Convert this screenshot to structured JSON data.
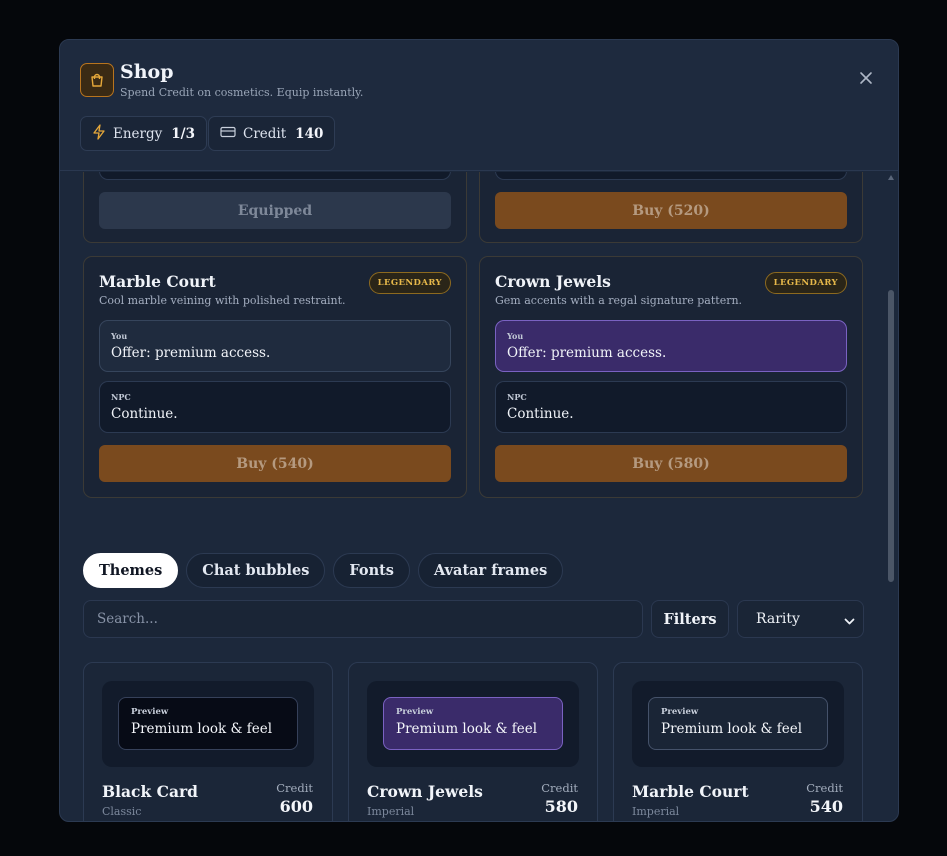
{
  "header": {
    "title": "Shop",
    "subtitle": "Spend Credit on cosmetics. Equip instantly.",
    "energy": {
      "label": "Energy",
      "value": "1/3"
    },
    "credit": {
      "label": "Credit",
      "value": "140"
    }
  },
  "top_cards": [
    {
      "button": "Equipped"
    },
    {
      "button": "Buy (520)"
    }
  ],
  "cards": [
    {
      "title": "Marble Court",
      "badge": "LEGENDARY",
      "desc": "Cool marble veining with polished restraint.",
      "you_label": "You",
      "you_msg": "Offer: premium access.",
      "npc_label": "NPC",
      "npc_msg": "Continue.",
      "button": "Buy (540)"
    },
    {
      "title": "Crown Jewels",
      "badge": "LEGENDARY",
      "desc": "Gem accents with a regal signature pattern.",
      "you_label": "You",
      "you_msg": "Offer: premium access.",
      "npc_label": "NPC",
      "npc_msg": "Continue.",
      "button": "Buy (580)"
    }
  ],
  "tabs": [
    "Themes",
    "Chat bubbles",
    "Fonts",
    "Avatar frames"
  ],
  "active_tab": "Themes",
  "search": {
    "placeholder": "Search..."
  },
  "filters_label": "Filters",
  "rarity": {
    "selected": "Rarity"
  },
  "tiles": [
    {
      "name": "Black Card",
      "sub": "Classic",
      "credit_label": "Credit",
      "price": "600",
      "preview_label": "Preview",
      "preview_text": "Premium look & feel"
    },
    {
      "name": "Crown Jewels",
      "sub": "Imperial",
      "credit_label": "Credit",
      "price": "580",
      "preview_label": "Preview",
      "preview_text": "Premium look & feel"
    },
    {
      "name": "Marble Court",
      "sub": "Imperial",
      "credit_label": "Credit",
      "price": "540",
      "preview_label": "Preview",
      "preview_text": "Premium look & feel"
    }
  ],
  "colors": {
    "accent_orange": "#7a4a1e",
    "legendary_gold": "#e6b84a",
    "purple_bubble": "#3a2b6a",
    "modal_bg": "#1c283b"
  },
  "icons": [
    "shopping-bag-icon",
    "close-icon",
    "lightning-icon",
    "credit-card-icon",
    "chevron-down-icon"
  ]
}
